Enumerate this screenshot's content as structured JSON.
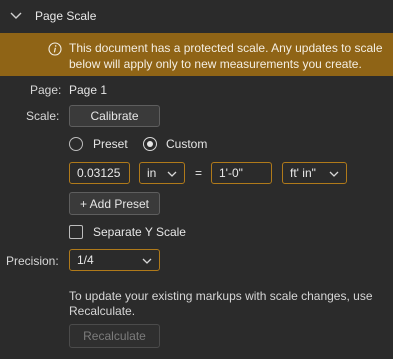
{
  "section": {
    "title": "Page Scale",
    "chevron_icon": "chevron-down-icon"
  },
  "banner": {
    "icon": "info-icon",
    "text": "This document has a protected scale. Any updates to scale below will apply only to new measurements you create."
  },
  "page": {
    "label": "Page:",
    "value": "Page 1"
  },
  "scale": {
    "label": "Scale:",
    "calibrate_label": "Calibrate",
    "preset_label": "Preset",
    "custom_label": "Custom",
    "selected_mode": "custom",
    "document_value": "0.03125",
    "document_unit": "in",
    "equals": "=",
    "real_value": "1'-0\"",
    "real_unit": "ft' in\"",
    "add_preset_label": "+ Add Preset",
    "separate_y_label": "Separate Y Scale",
    "separate_y_checked": false
  },
  "precision": {
    "label": "Precision:",
    "value": "1/4"
  },
  "recalculate": {
    "description": "To update your existing markups with scale changes, use Recalculate.",
    "button_label": "Recalculate",
    "enabled": false
  },
  "colors": {
    "background": "#2b2b2b",
    "banner": "#8f6416",
    "accent_border": "#b07a1a"
  }
}
